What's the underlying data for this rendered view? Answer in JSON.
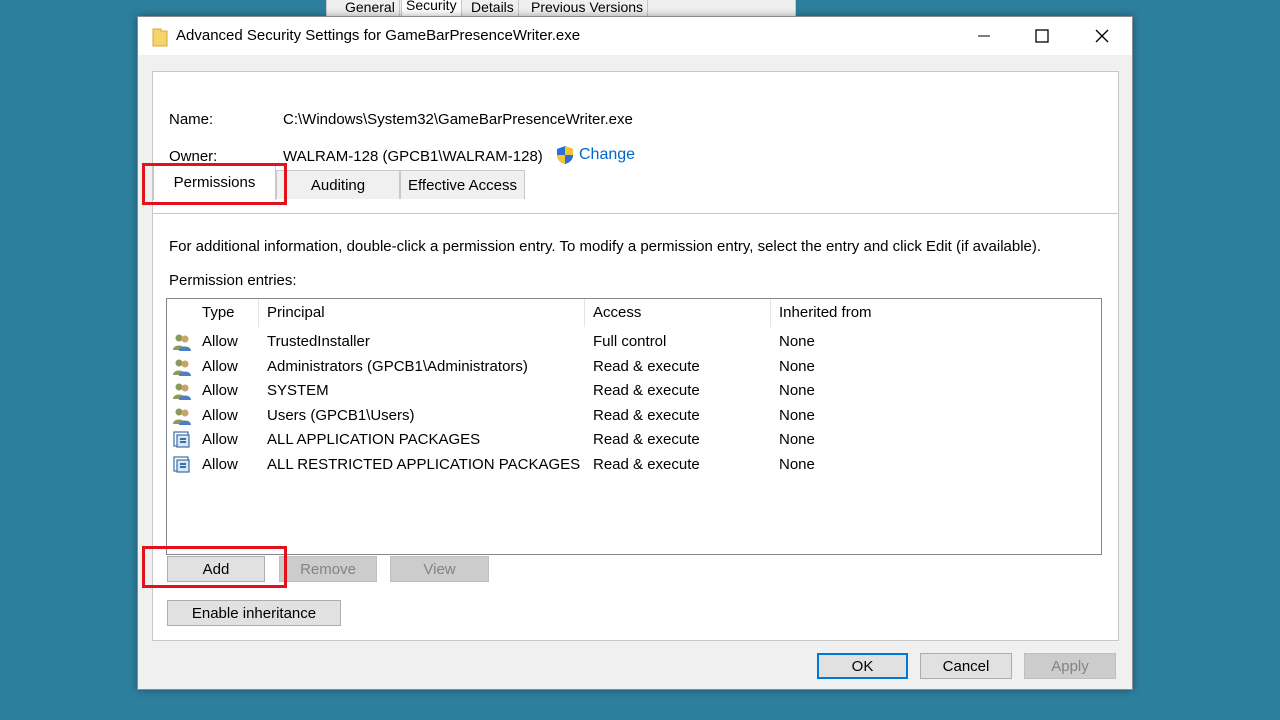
{
  "background_tabs": [
    "General",
    "Security",
    "Details",
    "Previous Versions"
  ],
  "window": {
    "title": "Advanced Security Settings for GameBarPresenceWriter.exe",
    "controls": [
      "minimize-icon",
      "maximize-icon",
      "close-icon"
    ]
  },
  "info": {
    "name_label": "Name:",
    "name_value": "C:\\Windows\\System32\\GameBarPresenceWriter.exe",
    "owner_label": "Owner:",
    "owner_value": "WALRAM-128 (GPCB1\\WALRAM-128)",
    "change_label": "Change"
  },
  "tabs": [
    "Permissions",
    "Auditing",
    "Effective Access"
  ],
  "selected_tab": "Permissions",
  "instructions": "For additional information, double-click a permission entry. To modify a permission entry, select the entry and click Edit (if available).",
  "entries_label": "Permission entries:",
  "columns": [
    "Type",
    "Principal",
    "Access",
    "Inherited from"
  ],
  "entries": [
    {
      "icon": "users-icon",
      "type": "Allow",
      "principal": "TrustedInstaller",
      "access": "Full control",
      "inherited": "None"
    },
    {
      "icon": "users-icon",
      "type": "Allow",
      "principal": "Administrators (GPCB1\\Administrators)",
      "access": "Read & execute",
      "inherited": "None"
    },
    {
      "icon": "users-icon",
      "type": "Allow",
      "principal": "SYSTEM",
      "access": "Read & execute",
      "inherited": "None"
    },
    {
      "icon": "users-icon",
      "type": "Allow",
      "principal": "Users (GPCB1\\Users)",
      "access": "Read & execute",
      "inherited": "None"
    },
    {
      "icon": "app-package-icon",
      "type": "Allow",
      "principal": "ALL APPLICATION PACKAGES",
      "access": "Read & execute",
      "inherited": "None"
    },
    {
      "icon": "app-package-icon",
      "type": "Allow",
      "principal": "ALL RESTRICTED APPLICATION PACKAGES",
      "access": "Read & execute",
      "inherited": "None"
    }
  ],
  "buttons": {
    "add": "Add",
    "remove": "Remove",
    "view": "View",
    "enable_inheritance": "Enable inheritance",
    "ok": "OK",
    "cancel": "Cancel",
    "apply": "Apply"
  },
  "highlight_color": "#e2121b",
  "link_color": "#0066cc"
}
